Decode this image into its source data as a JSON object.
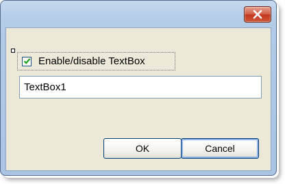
{
  "dialog": {
    "close_icon": "close-x-icon",
    "checkbox": {
      "label": "Enable/disable TextBox",
      "checked": true
    },
    "textbox": {
      "value": "TextBox1"
    },
    "buttons": {
      "ok_label": "OK",
      "cancel_label": "Cancel"
    }
  },
  "colors": {
    "titlebar": "#b2cbe7",
    "client_background": "#ece9d8",
    "close_button": "#c9472b",
    "checkmark": "#21a121"
  }
}
